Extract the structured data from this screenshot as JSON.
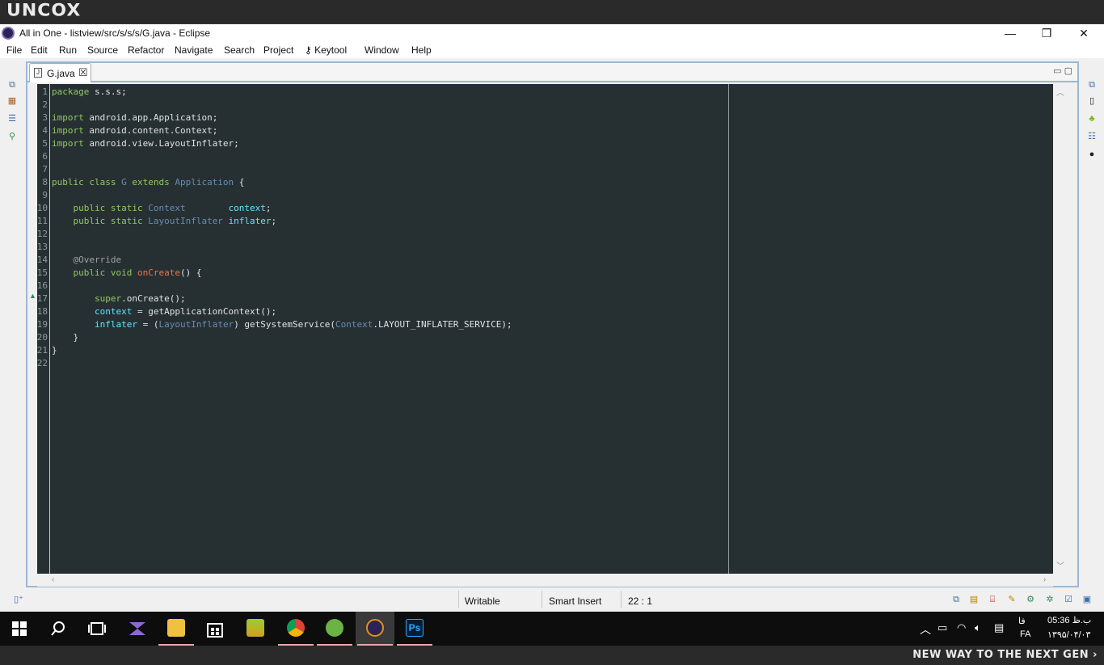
{
  "banner": {
    "brand": "UNCOX",
    "tagline": "NEW WAY TO THE NEXT GEN ›"
  },
  "window": {
    "title": "All in One - listview/src/s/s/s/G.java - Eclipse",
    "minimize": "—",
    "restore": "❐",
    "close": "✕"
  },
  "menu": [
    "File",
    "Edit",
    "Run",
    "Source",
    "Refactor",
    "Navigate",
    "Search",
    "Project",
    "Keytool",
    "Window",
    "Help"
  ],
  "editor": {
    "tab_label": "G.java",
    "line_numbers": [
      "1",
      "2",
      "3",
      "4",
      "5",
      "6",
      "7",
      "8",
      "9",
      "10",
      "11",
      "12",
      "13",
      "14",
      "15",
      "16",
      "17",
      "18",
      "19",
      "20",
      "21",
      "22"
    ]
  },
  "status": {
    "mode": "Writable",
    "insert": "Smart Insert",
    "position": "22 : 1"
  },
  "tray": {
    "time": "05:36 ب.ظ",
    "date": "۱۳۹۵/۰۴/۰۳",
    "lang_top": "فا",
    "lang": "FA"
  },
  "colors": {
    "editor_bg": "#263033",
    "keyword": "#93c763",
    "type": "#678cb1",
    "field": "#66e0ff",
    "method": "#e8774c",
    "annotation": "#a0a0a0",
    "tab_border": "#9cb7d6",
    "taskbar": "#0d0d0d"
  },
  "code": {
    "l1": {
      "kw": "package",
      "rest": " s.s.s;"
    },
    "l3": {
      "kw": "import",
      "rest": " android.app.Application;"
    },
    "l4": {
      "kw": "import",
      "rest": " android.content.Context;"
    },
    "l5": {
      "kw": "import",
      "rest": " android.view.LayoutInflater;"
    },
    "l8": {
      "kw1": "public class ",
      "cls": "G",
      "kw2": " extends ",
      "sup": "Application",
      "rest": " {"
    },
    "l10": {
      "kw": "    public static ",
      "ty": "Context",
      "sp": "        ",
      "fd": "context",
      "rest": ";"
    },
    "l11": {
      "kw": "    public static ",
      "ty": "LayoutInflater",
      "sp": " ",
      "fd": "inflater",
      "rest": ";"
    },
    "l14": {
      "an": "    @Override"
    },
    "l15": {
      "kw": "    public void ",
      "mt": "onCreate",
      "rest": "() {"
    },
    "l17": {
      "kw": "        super",
      "rest": ".onCreate();"
    },
    "l18": {
      "fd": "        context",
      "rest": " = getApplicationContext();"
    },
    "l19": {
      "fd": "        inflater",
      "p1": " = (",
      "ty": "LayoutInflater",
      "p2": ") getSystemService(",
      "ty2": "Context",
      "rest": ".LAYOUT_INFLATER_SERVICE);"
    },
    "l20": {
      "rest": "    }"
    },
    "l21": {
      "rest": "}"
    }
  }
}
